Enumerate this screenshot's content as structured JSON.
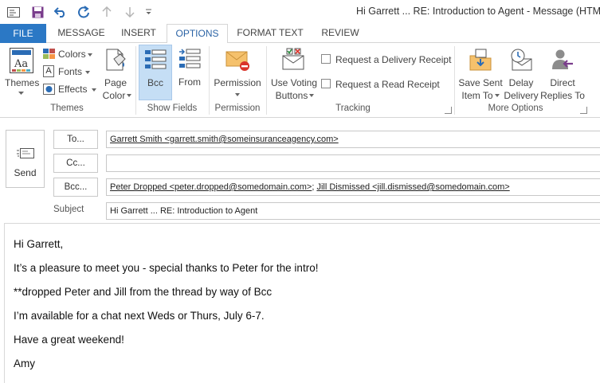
{
  "window": {
    "title": "Hi Garrett ... RE: Introduction to Agent - Message (HTML)"
  },
  "tabs": [
    "FILE",
    "MESSAGE",
    "INSERT",
    "OPTIONS",
    "FORMAT TEXT",
    "REVIEW"
  ],
  "ribbon": {
    "themes": {
      "themes_label": "Themes",
      "colors_label": "Colors",
      "fonts_label": "Fonts",
      "effects_label": "Effects",
      "page_color_line1": "Page",
      "page_color_line2": "Color",
      "group_label": "Themes"
    },
    "show_fields": {
      "bcc_label": "Bcc",
      "from_label": "From",
      "group_label": "Show Fields"
    },
    "permission": {
      "label": "Permission",
      "group_label": "Permission"
    },
    "tracking": {
      "voting_line1": "Use Voting",
      "voting_line2": "Buttons",
      "delivery_receipt": "Request a Delivery Receipt",
      "read_receipt": "Request a Read Receipt",
      "group_label": "Tracking"
    },
    "more_options": {
      "save_sent_line1": "Save Sent",
      "save_sent_line2": "Item To",
      "delay_line1": "Delay",
      "delay_line2": "Delivery",
      "direct_line1": "Direct",
      "direct_line2": "Replies To",
      "group_label": "More Options"
    }
  },
  "header": {
    "send_label": "Send",
    "to_label": "To...",
    "cc_label": "Cc...",
    "bcc_label": "Bcc...",
    "subject_label": "Subject",
    "to_recipient": "Garrett Smith <garrett.smith@someinsuranceagency.com>",
    "cc_value": "",
    "bcc_recipient_1": "Peter Dropped <peter.dropped@somedomain.com>",
    "bcc_separator": "; ",
    "bcc_recipient_2": "Jill Dismissed <jill.dismissed@somedomain.com>",
    "subject_value": "Hi Garrett ... RE: Introduction to Agent"
  },
  "body": {
    "lines": [
      "Hi Garrett,",
      "It’s a pleasure to meet you - special thanks to Peter for the intro!",
      "**dropped Peter and Jill from the thread by way of Bcc",
      "I’m available for a chat next Weds or Thurs, July 6-7.",
      "Have a great weekend!",
      "Amy"
    ]
  },
  "colors": {
    "file_tab": "#2b78c5",
    "active_tab_text": "#2b63a5",
    "selected_button": "#c5def5",
    "qat_purple": "#7a3d8c",
    "qat_blue": "#2b6cb5"
  }
}
